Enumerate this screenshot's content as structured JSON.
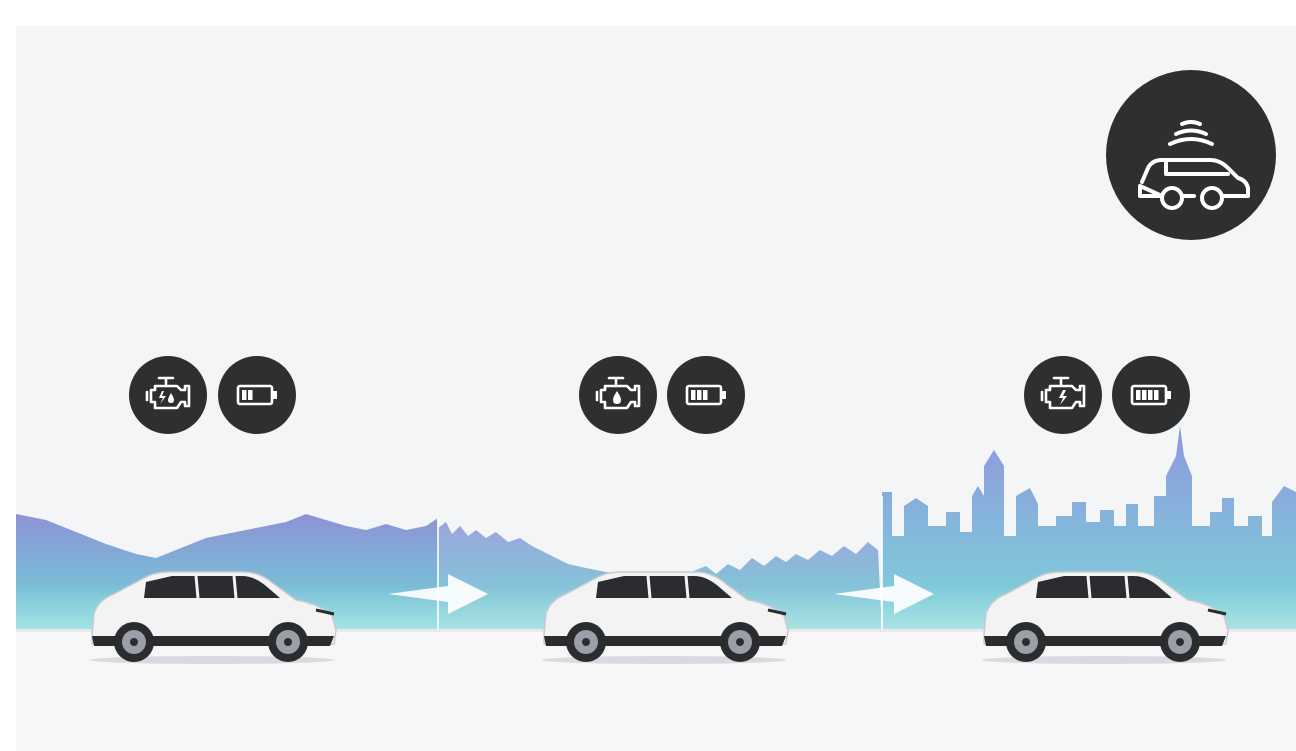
{
  "colors": {
    "background": "#f4f5f7",
    "badge": "#2e2f31",
    "icon_stroke": "#ffffff",
    "mountain_top": "#8d92d6",
    "mountain_bottom": "#6fd8d8",
    "city_top": "#8e98de",
    "city_bottom": "#7bd7d8",
    "road": "#f8f8f8",
    "car_body": "#f3f3f3",
    "car_dark": "#2b2c2f"
  },
  "stages": [
    {
      "name": "mountain",
      "engine_icon": "engine-lightning-drop-icon",
      "battery_icon": "battery-low-icon",
      "battery_level": 0.33
    },
    {
      "name": "hills",
      "engine_icon": "engine-drop-icon",
      "battery_icon": "battery-medium-icon",
      "battery_level": 0.66
    },
    {
      "name": "city",
      "engine_icon": "engine-lightning-icon",
      "battery_icon": "battery-full-icon",
      "battery_level": 1.0
    }
  ],
  "top_right_icon": "car-sensor-icon"
}
